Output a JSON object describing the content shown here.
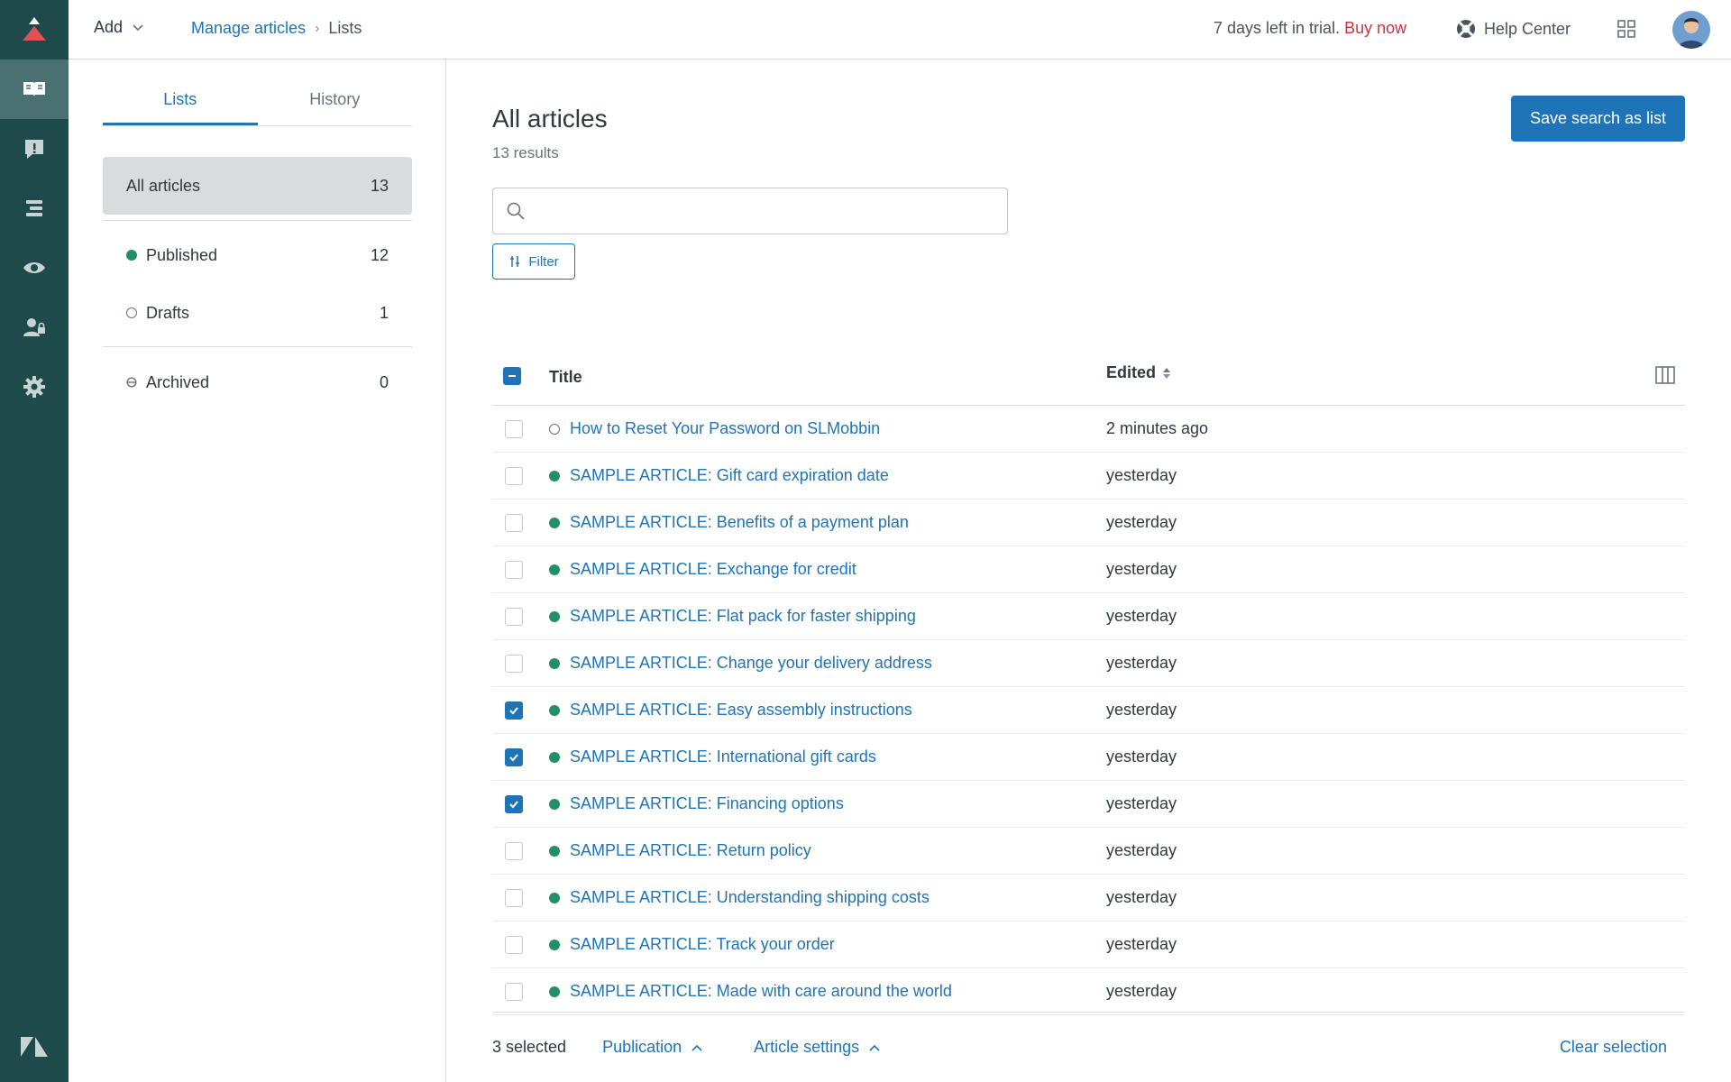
{
  "topbar": {
    "add_label": "Add",
    "breadcrumb": {
      "parent": "Manage articles",
      "current": "Lists"
    },
    "trial_text": "7 days left in trial.",
    "buy_now": "Buy now",
    "help_center": "Help Center"
  },
  "sidepanel": {
    "tabs": [
      {
        "label": "Lists"
      },
      {
        "label": "History"
      }
    ],
    "lists": {
      "all": {
        "label": "All articles",
        "count": "13"
      },
      "published": {
        "label": "Published",
        "count": "12"
      },
      "drafts": {
        "label": "Drafts",
        "count": "1"
      },
      "archived": {
        "label": "Archived",
        "count": "0"
      }
    }
  },
  "main": {
    "title": "All articles",
    "results": "13 results",
    "save_button": "Save search as list",
    "search_placeholder": "",
    "filter_label": "Filter",
    "columns": {
      "title": "Title",
      "edited": "Edited"
    },
    "rows": [
      {
        "title": "How to Reset Your Password on SLMobbin",
        "edited": "2 minutes ago",
        "status": "draft",
        "checked": false
      },
      {
        "title": "SAMPLE ARTICLE: Gift card expiration date",
        "edited": "yesterday",
        "status": "published",
        "checked": false
      },
      {
        "title": "SAMPLE ARTICLE: Benefits of a payment plan",
        "edited": "yesterday",
        "status": "published",
        "checked": false
      },
      {
        "title": "SAMPLE ARTICLE: Exchange for credit",
        "edited": "yesterday",
        "status": "published",
        "checked": false
      },
      {
        "title": "SAMPLE ARTICLE: Flat pack for faster shipping",
        "edited": "yesterday",
        "status": "published",
        "checked": false
      },
      {
        "title": "SAMPLE ARTICLE: Change your delivery address",
        "edited": "yesterday",
        "status": "published",
        "checked": false
      },
      {
        "title": "SAMPLE ARTICLE: Easy assembly instructions",
        "edited": "yesterday",
        "status": "published",
        "checked": true
      },
      {
        "title": "SAMPLE ARTICLE: International gift cards",
        "edited": "yesterday",
        "status": "published",
        "checked": true
      },
      {
        "title": "SAMPLE ARTICLE: Financing options",
        "edited": "yesterday",
        "status": "published",
        "checked": true
      },
      {
        "title": "SAMPLE ARTICLE: Return policy",
        "edited": "yesterday",
        "status": "published",
        "checked": false
      },
      {
        "title": "SAMPLE ARTICLE: Understanding shipping costs",
        "edited": "yesterday",
        "status": "published",
        "checked": false
      },
      {
        "title": "SAMPLE ARTICLE: Track your order",
        "edited": "yesterday",
        "status": "published",
        "checked": false
      },
      {
        "title": "SAMPLE ARTICLE: Made with care around the world",
        "edited": "yesterday",
        "status": "published",
        "checked": false
      }
    ]
  },
  "footer": {
    "selected": "3 selected",
    "publication": "Publication",
    "article_settings": "Article settings",
    "clear_selection": "Clear selection"
  },
  "colors": {
    "rail": "#1f4a4c",
    "accent": "#1f73b7",
    "published": "#228f67",
    "buy_now": "#cc3340"
  },
  "icons": {
    "rail": [
      "logo-icon",
      "guide-icon",
      "feedback-icon",
      "arrange-icon",
      "view-icon",
      "user-permissions-icon",
      "settings-icon",
      "zendesk-icon"
    ]
  }
}
